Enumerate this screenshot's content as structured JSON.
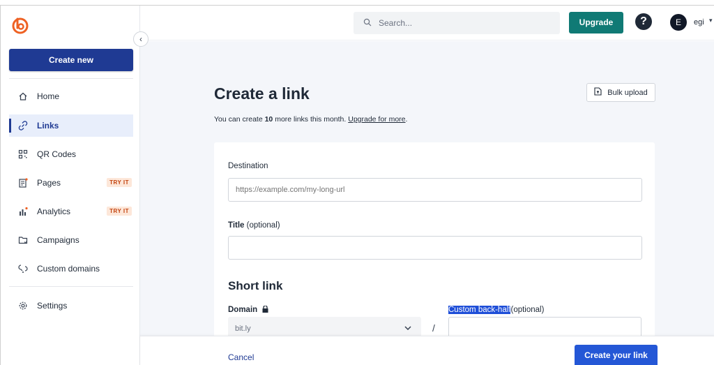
{
  "sidebar": {
    "create_label": "Create new",
    "collapse_glyph": "‹",
    "items": [
      {
        "label": "Home",
        "icon": "home-icon",
        "active": false
      },
      {
        "label": "Links",
        "icon": "link-icon",
        "active": true
      },
      {
        "label": "QR Codes",
        "icon": "qr-code-icon",
        "active": false
      },
      {
        "label": "Pages",
        "icon": "pages-icon",
        "active": false,
        "badge": "TRY IT"
      },
      {
        "label": "Analytics",
        "icon": "analytics-icon",
        "active": false,
        "badge": "TRY IT"
      },
      {
        "label": "Campaigns",
        "icon": "campaigns-icon",
        "active": false
      },
      {
        "label": "Custom domains",
        "icon": "custom-domains-icon",
        "active": false
      },
      {
        "label": "Settings",
        "icon": "settings-gear-icon",
        "active": false
      }
    ]
  },
  "topbar": {
    "search_placeholder": "Search...",
    "upgrade_label": "Upgrade",
    "help_glyph": "?",
    "avatar_initial": "E",
    "user_name": "egi"
  },
  "main": {
    "title": "Create a link",
    "bulk_upload_label": "Bulk upload",
    "limit_prefix": "You can create ",
    "limit_count": "10",
    "limit_suffix": " more links this month. ",
    "limit_link": "Upgrade for more",
    "limit_end": ".",
    "destination_label": "Destination",
    "destination_placeholder": "https://example.com/my-long-url",
    "title_label": "Title",
    "title_optional": " (optional)",
    "short_link_heading": "Short link",
    "domain_label": "Domain",
    "domain_value": "bit.ly",
    "separator": "/",
    "backhalf_label": "Custom back-half",
    "backhalf_optional": "(optional)"
  },
  "footer": {
    "cancel_label": "Cancel",
    "submit_label": "Create your link"
  },
  "colors": {
    "brand_primary": "#1f3a93",
    "upgrade": "#107a75",
    "submit": "#2457d6",
    "logo_orange": "#ee6123",
    "badge_text": "#c2410c"
  }
}
